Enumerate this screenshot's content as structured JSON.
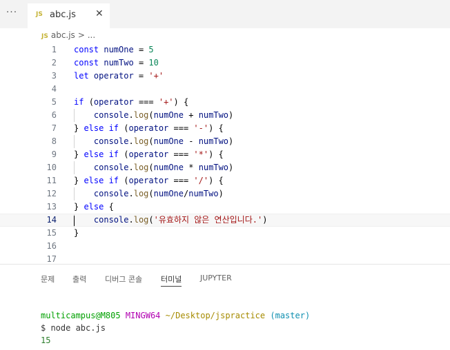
{
  "toolbar": {
    "more_label": "···"
  },
  "tab": {
    "badge": "JS",
    "title": "abc.js",
    "close": "✕"
  },
  "breadcrumb": {
    "badge": "JS",
    "file": "abc.js",
    "separator": ">",
    "ellipsis": "..."
  },
  "editor": {
    "current_line": 14,
    "lines": [
      {
        "n": "1",
        "segments": [
          [
            "kw",
            "const "
          ],
          [
            "var",
            "numOne"
          ],
          [
            "op",
            " = "
          ],
          [
            "num",
            "5"
          ]
        ]
      },
      {
        "n": "2",
        "segments": [
          [
            "kw",
            "const "
          ],
          [
            "var",
            "numTwo"
          ],
          [
            "op",
            " = "
          ],
          [
            "num",
            "10"
          ]
        ]
      },
      {
        "n": "3",
        "segments": [
          [
            "kw",
            "let "
          ],
          [
            "var",
            "operator"
          ],
          [
            "op",
            " = "
          ],
          [
            "str",
            "'+'"
          ]
        ]
      },
      {
        "n": "4",
        "segments": []
      },
      {
        "n": "5",
        "segments": [
          [
            "kw",
            "if "
          ],
          [
            "op",
            "("
          ],
          [
            "var",
            "operator"
          ],
          [
            "op",
            " === "
          ],
          [
            "str",
            "'+'"
          ],
          [
            "op",
            ") {"
          ]
        ]
      },
      {
        "n": "6",
        "indent": true,
        "segments": [
          [
            "var",
            "    console"
          ],
          [
            "op",
            "."
          ],
          [
            "fn",
            "log"
          ],
          [
            "op",
            "("
          ],
          [
            "var",
            "numOne"
          ],
          [
            "op",
            " + "
          ],
          [
            "var",
            "numTwo"
          ],
          [
            "op",
            ")"
          ]
        ]
      },
      {
        "n": "7",
        "segments": [
          [
            "op",
            "} "
          ],
          [
            "kw",
            "else if "
          ],
          [
            "op",
            "("
          ],
          [
            "var",
            "operator"
          ],
          [
            "op",
            " === "
          ],
          [
            "str",
            "'-'"
          ],
          [
            "op",
            ") {"
          ]
        ]
      },
      {
        "n": "8",
        "indent": true,
        "segments": [
          [
            "var",
            "    console"
          ],
          [
            "op",
            "."
          ],
          [
            "fn",
            "log"
          ],
          [
            "op",
            "("
          ],
          [
            "var",
            "numOne"
          ],
          [
            "op",
            " - "
          ],
          [
            "var",
            "numTwo"
          ],
          [
            "op",
            ")"
          ]
        ]
      },
      {
        "n": "9",
        "segments": [
          [
            "op",
            "} "
          ],
          [
            "kw",
            "else if "
          ],
          [
            "op",
            "("
          ],
          [
            "var",
            "operator"
          ],
          [
            "op",
            " === "
          ],
          [
            "str",
            "'*'"
          ],
          [
            "op",
            ") {"
          ]
        ]
      },
      {
        "n": "10",
        "indent": true,
        "segments": [
          [
            "var",
            "    console"
          ],
          [
            "op",
            "."
          ],
          [
            "fn",
            "log"
          ],
          [
            "op",
            "("
          ],
          [
            "var",
            "numOne"
          ],
          [
            "op",
            " * "
          ],
          [
            "var",
            "numTwo"
          ],
          [
            "op",
            ")"
          ]
        ]
      },
      {
        "n": "11",
        "segments": [
          [
            "op",
            "} "
          ],
          [
            "kw",
            "else if "
          ],
          [
            "op",
            "("
          ],
          [
            "var",
            "operator"
          ],
          [
            "op",
            " === "
          ],
          [
            "str",
            "'/'"
          ],
          [
            "op",
            ") {"
          ]
        ]
      },
      {
        "n": "12",
        "indent": true,
        "segments": [
          [
            "var",
            "    console"
          ],
          [
            "op",
            "."
          ],
          [
            "fn",
            "log"
          ],
          [
            "op",
            "("
          ],
          [
            "var",
            "numOne"
          ],
          [
            "op",
            "/"
          ],
          [
            "var",
            "numTwo"
          ],
          [
            "op",
            ")"
          ]
        ]
      },
      {
        "n": "13",
        "segments": [
          [
            "op",
            "} "
          ],
          [
            "kw",
            "else "
          ],
          [
            "op",
            "{"
          ]
        ]
      },
      {
        "n": "14",
        "indent": true,
        "segments": [
          [
            "var",
            "    console"
          ],
          [
            "op",
            "."
          ],
          [
            "fn",
            "log"
          ],
          [
            "op",
            "("
          ],
          [
            "str",
            "'유효하지 않은 연산입니다.'"
          ],
          [
            "op",
            ")"
          ]
        ]
      },
      {
        "n": "15",
        "segments": [
          [
            "op",
            "}"
          ]
        ]
      },
      {
        "n": "16",
        "segments": []
      },
      {
        "n": "17",
        "segments": []
      }
    ]
  },
  "panel": {
    "tabs": [
      {
        "label": "문제",
        "active": false
      },
      {
        "label": "출력",
        "active": false
      },
      {
        "label": "디버그 콘솔",
        "active": false
      },
      {
        "label": "터미널",
        "active": true
      },
      {
        "label": "JUPYTER",
        "active": false
      }
    ]
  },
  "terminal": {
    "user": "multicampus@M805",
    "system": "MINGW64",
    "path": "~/Desktop/jspractice",
    "branch": "(master)",
    "command": "$ node abc.js",
    "output": "15"
  },
  "colors": {
    "keyword": "#0000ff",
    "number": "#098658",
    "string": "#a31515",
    "function": "#795e26",
    "variable": "#001080",
    "terminal_user": "#00a000",
    "terminal_system": "#b100b1",
    "terminal_path": "#a68b00",
    "terminal_branch": "#0f8fb0"
  }
}
